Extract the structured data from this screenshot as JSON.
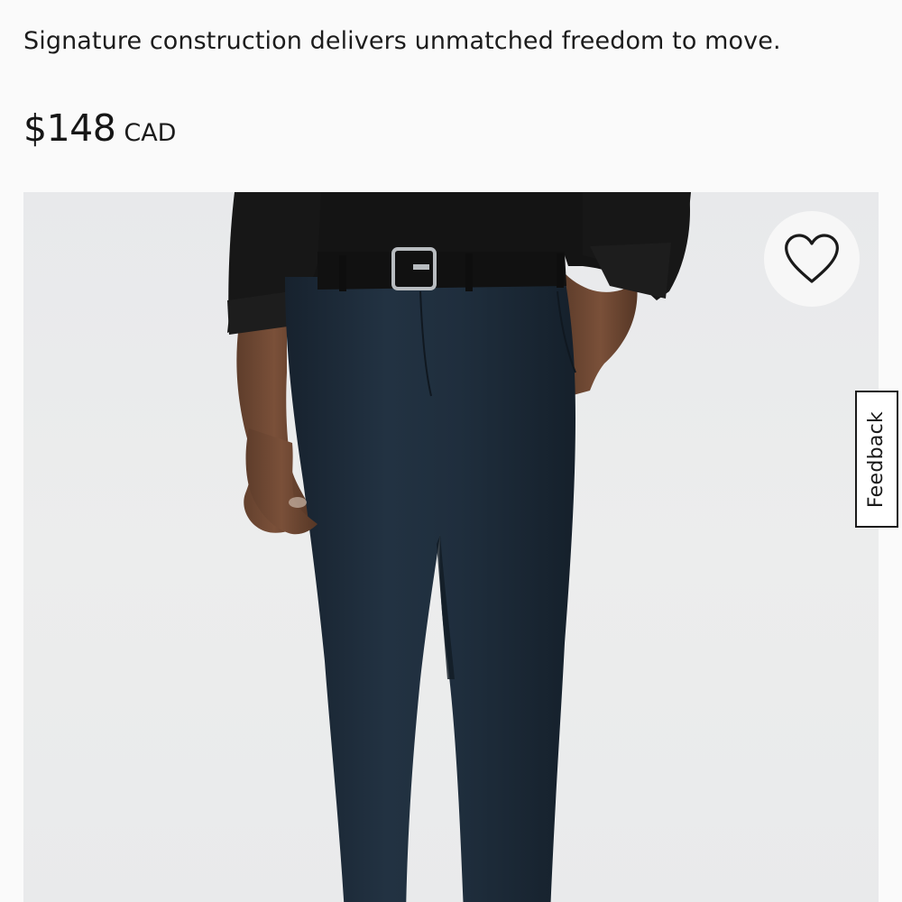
{
  "product": {
    "tagline": "Signature construction delivers unmatched freedom to move.",
    "price": "$148",
    "currency": "CAD",
    "image_alt": "Model wearing navy pants with black belt and black shirt"
  },
  "wishlist": {
    "icon": "heart-outline-icon"
  },
  "feedback": {
    "label": "Feedback"
  },
  "colors": {
    "background": "#fafafa",
    "image_background": "#eaebec",
    "pants": "#1c2a38",
    "shirt": "#141414",
    "text": "#1a1a1a"
  }
}
